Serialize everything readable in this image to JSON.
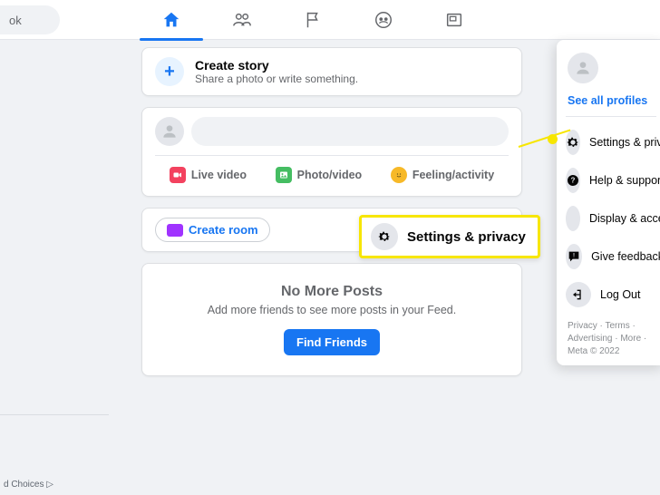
{
  "search": {
    "placeholder": "ok"
  },
  "create_story": {
    "title": "Create story",
    "sub": "Share a photo or write something."
  },
  "composer": {
    "live": "Live video",
    "photo": "Photo/video",
    "feeling": "Feeling/activity"
  },
  "rooms": {
    "button": "Create room"
  },
  "nomore": {
    "title": "No More Posts",
    "sub": "Add more friends to see more posts in your Feed.",
    "button": "Find Friends"
  },
  "panel": {
    "see_all": "See all profiles",
    "items": {
      "settings": "Settings & privacy",
      "help": "Help & support",
      "display": "Display & accessibility",
      "feedback": "Give feedback",
      "logout": "Log Out"
    },
    "footer": "Privacy · Terms · Advertising · More · Meta © 2022"
  },
  "callout": {
    "label": "Settings & privacy"
  },
  "bottom": {
    "choices": "d Choices ▷"
  }
}
